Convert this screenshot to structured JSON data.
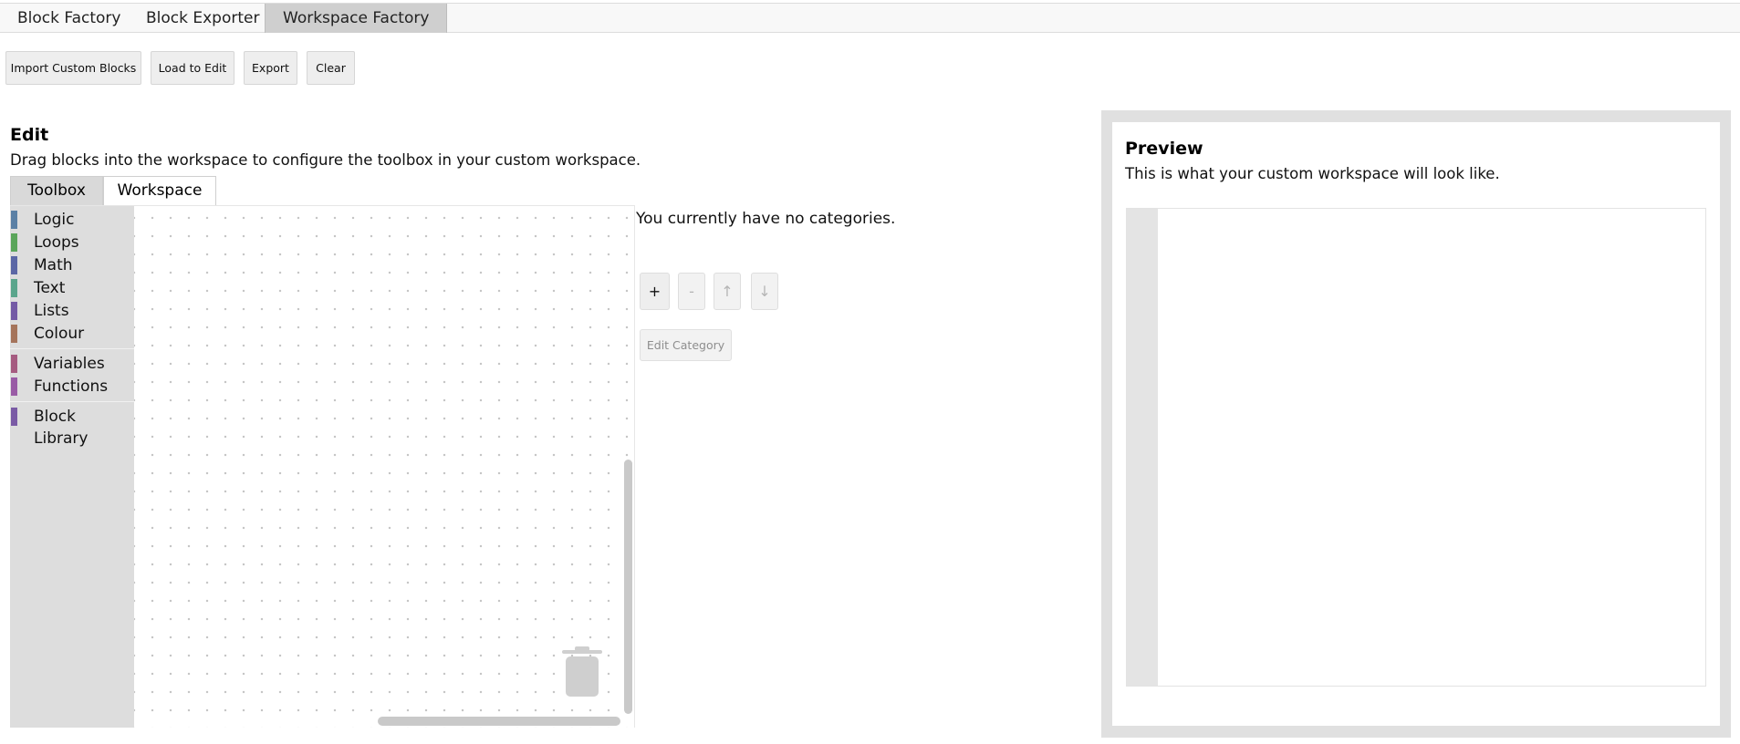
{
  "top_tabs": [
    {
      "label": "Block Factory"
    },
    {
      "label": "Block Exporter"
    },
    {
      "label": "Workspace Factory",
      "active": true
    }
  ],
  "toolbar": {
    "import_label": "Import Custom Blocks",
    "load_label": "Load to Edit",
    "export_label": "Export",
    "clear_label": "Clear"
  },
  "edit": {
    "title": "Edit",
    "description": "Drag blocks into the workspace to configure the toolbox in your custom workspace.",
    "tabs": [
      {
        "label": "Toolbox",
        "active": true
      },
      {
        "label": "Workspace"
      }
    ],
    "categories": [
      {
        "label": "Logic",
        "color": "#5b80a5"
      },
      {
        "label": "Loops",
        "color": "#5ba55b"
      },
      {
        "label": "Math",
        "color": "#5b67a5"
      },
      {
        "label": "Text",
        "color": "#5ba58c"
      },
      {
        "label": "Lists",
        "color": "#745ba5"
      },
      {
        "label": "Colour",
        "color": "#a5745b"
      },
      {
        "label": "Variables",
        "color": "#a55b80"
      },
      {
        "label": "Functions",
        "color": "#995ba5"
      },
      {
        "label": "Block Library",
        "color": "#7a5ba5"
      }
    ],
    "no_categories_text": "You currently have no categories.",
    "controls": {
      "add": "+",
      "remove": "-",
      "up": "↑",
      "down": "↓",
      "edit_category": "Edit Category"
    }
  },
  "preview": {
    "title": "Preview",
    "description": "This is what your custom workspace will look like."
  },
  "colors": {
    "toolbox_bg": "#dddddd",
    "active_tab_bg": "#cfcfcf",
    "button_bg": "#eeeeee",
    "preview_frame": "#e0e0e0"
  },
  "icons": {
    "trash": "trash-can-icon"
  }
}
